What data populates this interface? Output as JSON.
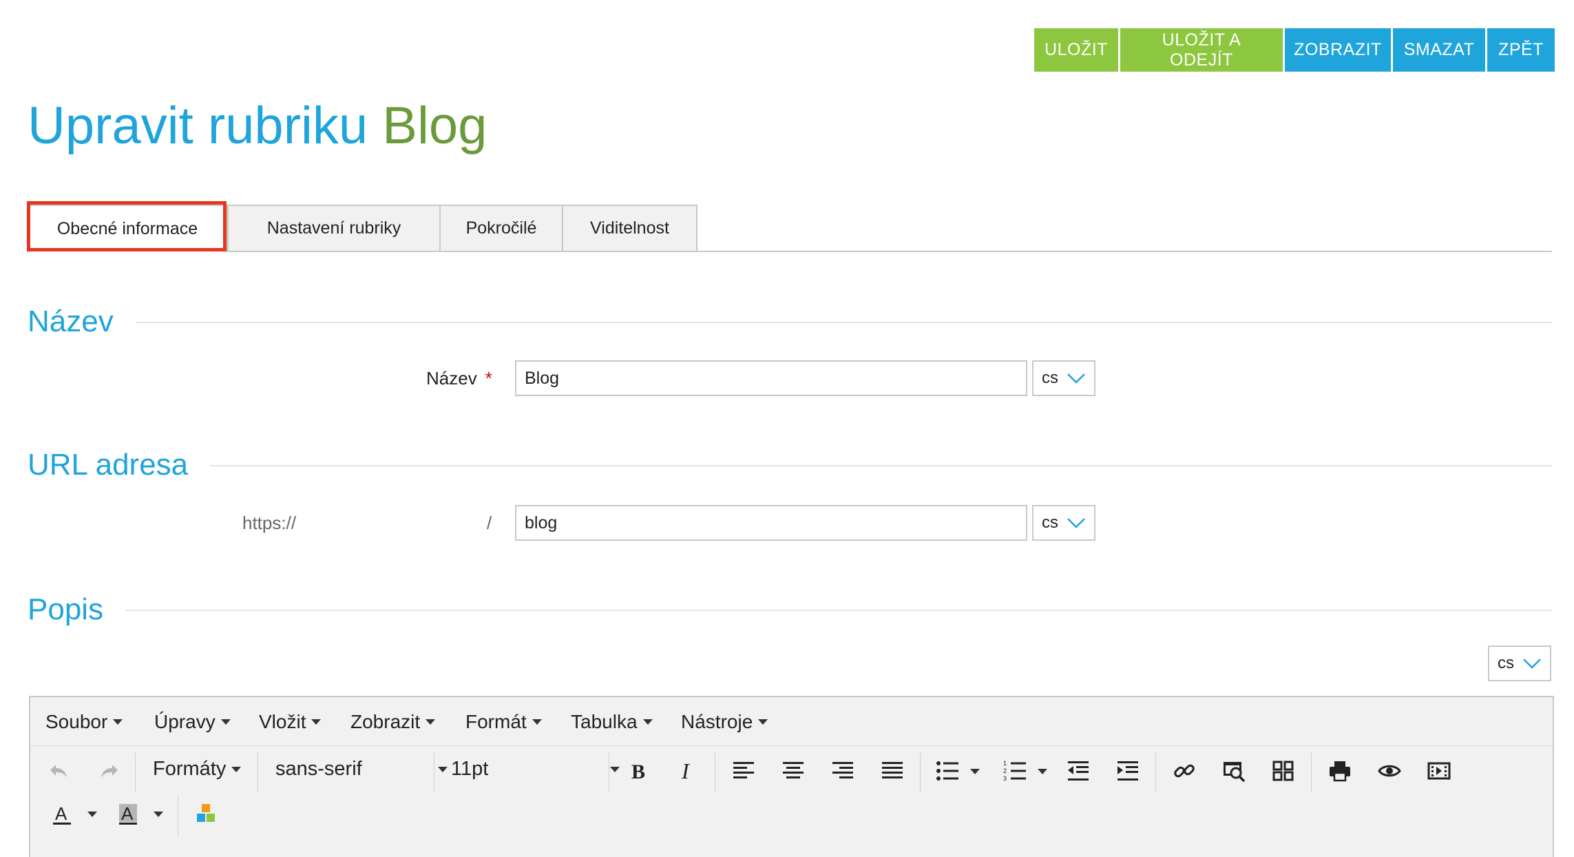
{
  "toolbar": {
    "save": "ULOŽIT",
    "save_exit": "ULOŽIT A ODEJÍT",
    "show": "ZOBRAZIT",
    "delete": "SMAZAT",
    "back": "ZPĚT"
  },
  "title": {
    "prefix": "Upravit rubriku",
    "name": "Blog"
  },
  "tabs": [
    {
      "label": "Obecné informace",
      "active": true
    },
    {
      "label": "Nastavení rubriky",
      "active": false
    },
    {
      "label": "Pokročilé",
      "active": false
    },
    {
      "label": "Viditelnost",
      "active": false
    }
  ],
  "sections": {
    "name": {
      "heading": "Název",
      "label": "Název",
      "required_mark": "*",
      "value": "Blog",
      "lang": "cs"
    },
    "url": {
      "heading": "URL adresa",
      "prefix": "https://",
      "separator": "/",
      "value": "blog",
      "lang": "cs"
    },
    "description": {
      "heading": "Popis",
      "lang": "cs"
    }
  },
  "editor": {
    "menus": [
      "Soubor",
      "Úpravy",
      "Vložit",
      "Zobrazit",
      "Formát",
      "Tabulka",
      "Nástroje"
    ],
    "formats_label": "Formáty",
    "font_family": "sans-serif",
    "font_size": "11pt"
  },
  "colors": {
    "green": "#8dc63f",
    "blue": "#1fa4dc",
    "title_green": "#6b9a3a",
    "highlight": "#e8361e"
  }
}
